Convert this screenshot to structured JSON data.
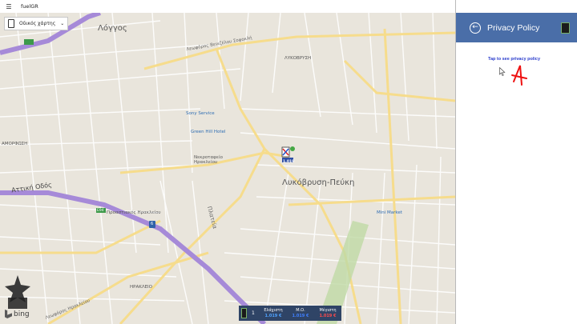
{
  "window": {
    "title": "fuelGR",
    "menu_icon": "hamburger-icon",
    "controls": [
      "fullscreen-icon",
      "minimize-icon",
      "restore-icon",
      "close-icon"
    ]
  },
  "map": {
    "map_type_selector": {
      "value": "Οδικός χάρτης",
      "icon": "phone-icon"
    },
    "labels": {
      "logos": "Λόγγος",
      "lykovrysi_peuki": "Λυκόβρυση-Πεύκη",
      "lykovrysi": "ΛΥΚΟΒΡΥΣΗ",
      "attiki_odos": "Αττική Οδός",
      "amorfosi": "ΑΜΟΡΦΩΣΗ",
      "irakleio": "ΗΡΑΚΛΕΙΟ",
      "sony_service": "Sony Service",
      "green_hill_hotel": "Green Hill Hotel",
      "nekrotafeio": "Νεκροταφείο Ηρακλείου",
      "mini_market": "Mini Market",
      "plateia": "Πλατεία",
      "leoforos_venizelou": "Λεωφόρος Βενιζέλου Σοφοκλή",
      "leoforos_irakleiou": "Λεωφόρος Ηρακλείου",
      "sidiro_station": "Προαστιακός Ηρακλείου",
      "e94": "E94",
      "route_6": "6",
      "pin_price": "1.019"
    },
    "attribution": "bing",
    "corner_logo": "fuelgr-corner-logo"
  },
  "price_bar": {
    "count": "1",
    "columns": [
      {
        "label": "Ελάχιστη",
        "value": "1.019 €",
        "color": "#4fa3ff"
      },
      {
        "label": "Μ.Ο.",
        "value": "1.019 €",
        "color": "#3f7fff"
      },
      {
        "label": "Μέγιστη",
        "value": "1.019 €",
        "color": "#ff4b4b"
      }
    ]
  },
  "panel": {
    "title": "Privacy Policy",
    "back_icon": "back-arrow-icon",
    "logo_icon": "fuel-pump-icon",
    "link_text": "Tap to see privacy policy"
  },
  "colors": {
    "header_bg": "#4a6ea8",
    "price_bar_bg": "#2f4466",
    "link": "#2a3ccc",
    "map_bg": "#e9e5dc"
  }
}
